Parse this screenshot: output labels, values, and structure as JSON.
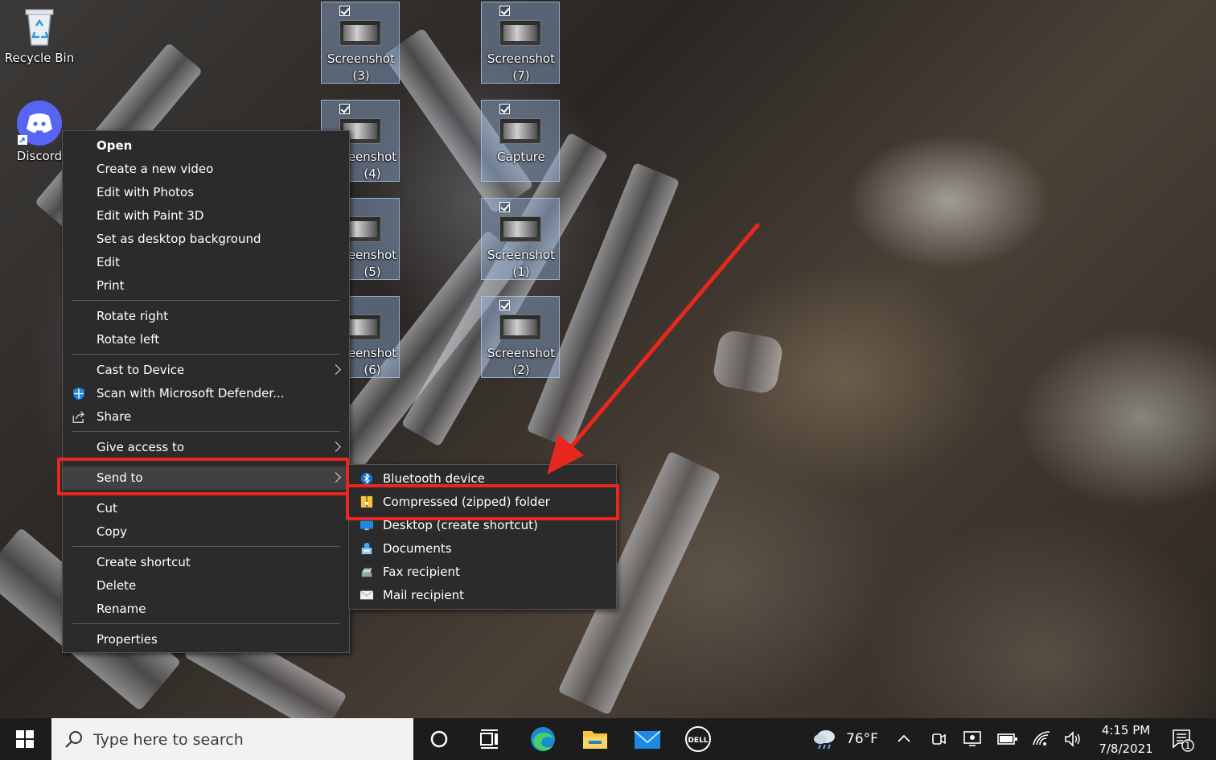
{
  "desktop": {
    "recycle_bin": {
      "label": "Recycle Bin"
    },
    "discord": {
      "label": "Discord"
    },
    "files": [
      {
        "line1": "Screenshot",
        "line2": "(3)"
      },
      {
        "line1": "Screenshot",
        "line2": "(7)"
      },
      {
        "line1": "eenshot",
        "line2": "(4)"
      },
      {
        "line1": "Capture",
        "line2": ""
      },
      {
        "line1": "eenshot",
        "line2": "(5)"
      },
      {
        "line1": "Screenshot",
        "line2": "(1)"
      },
      {
        "line1": "eenshot",
        "line2": "(6)"
      },
      {
        "line1": "Screenshot",
        "line2": "(2)"
      }
    ]
  },
  "context_menu": {
    "items": [
      {
        "label": "Open",
        "bold": true
      },
      {
        "label": "Create a new video"
      },
      {
        "label": "Edit with Photos"
      },
      {
        "label": "Edit with Paint 3D"
      },
      {
        "label": "Set as desktop background"
      },
      {
        "label": "Edit"
      },
      {
        "label": "Print"
      },
      {
        "label": "Rotate right"
      },
      {
        "label": "Rotate left"
      },
      {
        "label": "Cast to Device",
        "submenu": true
      },
      {
        "label": "Scan with Microsoft Defender...",
        "icon": "defender-shield-icon"
      },
      {
        "label": "Share",
        "icon": "share-icon"
      },
      {
        "label": "Give access to",
        "submenu": true
      },
      {
        "label": "Send to",
        "submenu": true,
        "highlighted": true
      },
      {
        "label": "Cut"
      },
      {
        "label": "Copy"
      },
      {
        "label": "Create shortcut"
      },
      {
        "label": "Delete"
      },
      {
        "label": "Rename"
      },
      {
        "label": "Properties"
      }
    ]
  },
  "send_to_menu": {
    "items": [
      {
        "label": "Bluetooth device",
        "icon": "bluetooth-icon"
      },
      {
        "label": "Compressed (zipped) folder",
        "icon": "zip-folder-icon",
        "highlighted": true
      },
      {
        "label": "Desktop (create shortcut)",
        "icon": "desktop-icon"
      },
      {
        "label": "Documents",
        "icon": "documents-icon"
      },
      {
        "label": "Fax recipient",
        "icon": "fax-icon"
      },
      {
        "label": "Mail recipient",
        "icon": "mail-icon"
      }
    ]
  },
  "taskbar": {
    "search_placeholder": "Type here to search",
    "weather": "76°F",
    "time": "4:15 PM",
    "date": "7/8/2021",
    "notification_count": "1",
    "apps": [
      "cortana-icon",
      "task-view-icon",
      "edge-icon",
      "file-explorer-icon",
      "mail-icon",
      "dell-icon"
    ]
  },
  "annotation": {
    "highlight_color": "#e8281e"
  }
}
